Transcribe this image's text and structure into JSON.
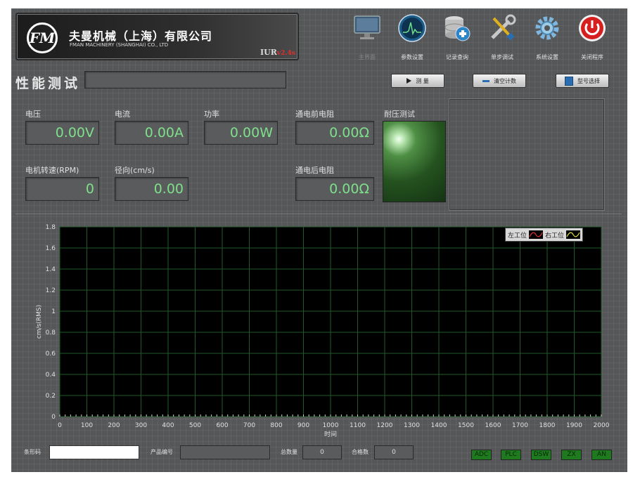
{
  "header": {
    "logo_mark": "FM",
    "company_cn": "夫曼机械（上海）有限公司",
    "company_en": "FMAN MACHINERY (SHANGHAI) CO., LTD",
    "version_prefix": "IUR",
    "version_suffix": "v2.4s",
    "version_color": "#e03030"
  },
  "toolbar": [
    {
      "id": "main",
      "label": "主界面",
      "icon": "monitor-icon",
      "enabled": false
    },
    {
      "id": "params",
      "label": "参数设置",
      "icon": "oscilloscope-icon",
      "enabled": true
    },
    {
      "id": "records",
      "label": "记录查询",
      "icon": "database-icon",
      "enabled": true
    },
    {
      "id": "step",
      "label": "单步调试",
      "icon": "tools-icon",
      "enabled": true
    },
    {
      "id": "system",
      "label": "系统设置",
      "icon": "gear-icon",
      "enabled": true
    },
    {
      "id": "close",
      "label": "关闭程序",
      "icon": "power-icon",
      "enabled": true
    }
  ],
  "page": {
    "title": "性能测试",
    "title_input": ""
  },
  "actions": {
    "measure": "测 量",
    "clear": "清空计数",
    "model": "型号选择"
  },
  "measurements": {
    "voltage": {
      "label": "电压",
      "value": "0.00V"
    },
    "current": {
      "label": "电流",
      "value": "0.00A"
    },
    "power": {
      "label": "功率",
      "value": "0.00W"
    },
    "pre_resistance": {
      "label": "通电前电阻",
      "value": "0.00Ω"
    },
    "rpm": {
      "label": "电机转速(RPM)",
      "value": "0"
    },
    "radial": {
      "label": "径向(cm/s)",
      "value": "0.00"
    },
    "post_resistance": {
      "label": "通电后电阻",
      "value": "0.00Ω"
    },
    "withstand": {
      "label": "耐压测试"
    },
    "value_color": "#7ee08a"
  },
  "chart_data": {
    "type": "line",
    "xlabel": "时间",
    "ylabel": "cm/s(RMS)",
    "xlim": [
      0,
      2000
    ],
    "ylim": [
      0,
      1.8
    ],
    "x_ticks": [
      0,
      100,
      200,
      300,
      400,
      500,
      600,
      700,
      800,
      900,
      1000,
      1100,
      1200,
      1300,
      1400,
      1500,
      1600,
      1700,
      1800,
      1900,
      2000
    ],
    "y_ticks": [
      0,
      0.2,
      0.4,
      0.6,
      0.8,
      1,
      1.2,
      1.4,
      1.6,
      1.8
    ],
    "y_tick_labels": [
      "0",
      "0.2",
      "0.4",
      "0.6",
      "0.8",
      "1",
      "1.2",
      "1.4",
      "1.6",
      "1.8"
    ],
    "grid": true,
    "grid_color": "#1f5a2a",
    "series": [
      {
        "name": "左工位",
        "color": "#e03030",
        "values": []
      },
      {
        "name": "右工位",
        "color": "#e0e040",
        "values": []
      }
    ],
    "legend": "top-right"
  },
  "footer": {
    "barcode_label": "条形码",
    "barcode_value": "",
    "product_label": "产品编号",
    "product_value": "",
    "total_label": "总数量",
    "total_value": "0",
    "pass_label": "合格数",
    "pass_value": "0",
    "status": [
      "ADC",
      "PLC",
      "DSW",
      "ZX",
      "AN"
    ],
    "status_color": "#1f7a1f"
  }
}
